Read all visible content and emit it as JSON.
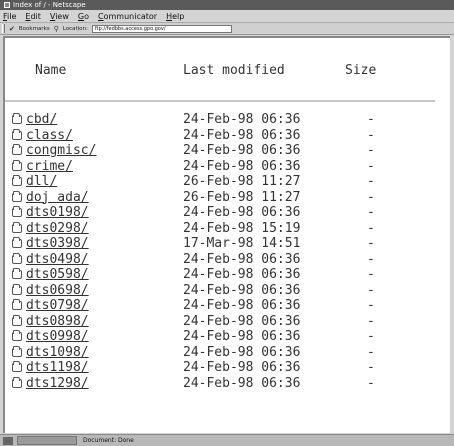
{
  "window": {
    "title": "Index of / - Netscape"
  },
  "menu": [
    "File",
    "Edit",
    "View",
    "Go",
    "Communicator",
    "Help"
  ],
  "toolbar": {
    "bookmarks_label": "Bookmarks",
    "location_label": "Location:",
    "location_value": "ftp://fedbbs.access.gpo.gov/"
  },
  "table": {
    "headers": {
      "name": "Name",
      "modified": "Last modified",
      "size": "Size"
    },
    "rows": [
      {
        "name": "cbd/",
        "modified": "24-Feb-98 06:36",
        "size": "-"
      },
      {
        "name": "class/",
        "modified": "24-Feb-98 06:36",
        "size": "-"
      },
      {
        "name": "congmisc/",
        "modified": "24-Feb-98 06:36",
        "size": "-"
      },
      {
        "name": "crime/",
        "modified": "24-Feb-98 06:36",
        "size": "-"
      },
      {
        "name": "dll/",
        "modified": "26-Feb-98 11:27",
        "size": "-"
      },
      {
        "name": "doj ada/",
        "modified": "26-Feb-98 11:27",
        "size": "-"
      },
      {
        "name": "dts0198/",
        "modified": "24-Feb-98 06:36",
        "size": "-"
      },
      {
        "name": "dts0298/",
        "modified": "24-Feb-98 15:19",
        "size": "-"
      },
      {
        "name": "dts0398/",
        "modified": "17-Mar-98 14:51",
        "size": "-"
      },
      {
        "name": "dts0498/",
        "modified": "24-Feb-98 06:36",
        "size": "-"
      },
      {
        "name": "dts0598/",
        "modified": "24-Feb-98 06:36",
        "size": "-"
      },
      {
        "name": "dts0698/",
        "modified": "24-Feb-98 06:36",
        "size": "-"
      },
      {
        "name": "dts0798/",
        "modified": "24-Feb-98 06:36",
        "size": "-"
      },
      {
        "name": "dts0898/",
        "modified": "24-Feb-98 06:36",
        "size": "-"
      },
      {
        "name": "dts0998/",
        "modified": "24-Feb-98 06:36",
        "size": "-"
      },
      {
        "name": "dts1098/",
        "modified": "24-Feb-98 06:36",
        "size": "-"
      },
      {
        "name": "dts1198/",
        "modified": "24-Feb-98 06:36",
        "size": "-"
      },
      {
        "name": "dts1298/",
        "modified": "24-Feb-98 06:36",
        "size": "-"
      }
    ]
  },
  "status": {
    "text": "Document: Done"
  }
}
